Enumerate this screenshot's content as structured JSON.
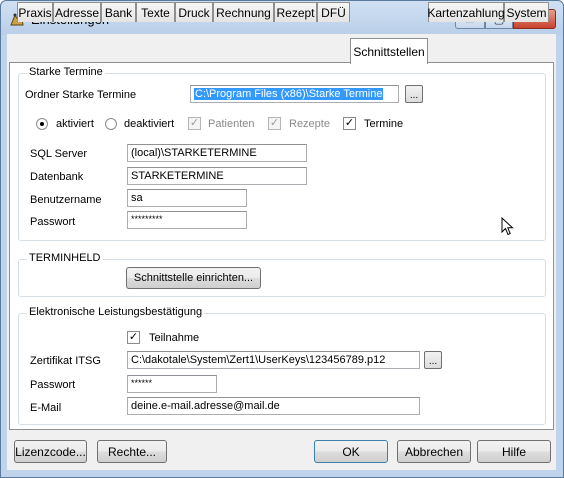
{
  "window": {
    "title": "Einstellungen",
    "min_glyph": "▭",
    "max_glyph": "▢",
    "close_glyph": "✕"
  },
  "tabs": [
    {
      "label": "Praxis"
    },
    {
      "label": "Adresse"
    },
    {
      "label": "Bank"
    },
    {
      "label": "Texte"
    },
    {
      "label": "Druck"
    },
    {
      "label": "Rechnung"
    },
    {
      "label": "Rezept"
    },
    {
      "label": "DFÜ"
    },
    {
      "label": "Schnittstellen",
      "active": true
    },
    {
      "label": "Kartenzahlung"
    },
    {
      "label": "System"
    }
  ],
  "starke_termine": {
    "group_title": "Starke Termine",
    "ordner_label": "Ordner Starke Termine",
    "ordner_value": "C:\\Program Files (x86)\\Starke Termine",
    "browse_label": "...",
    "radio_aktiviert": "aktiviert",
    "radio_deaktiviert": "deaktiviert",
    "chk_patienten": "Patienten",
    "chk_rezepte": "Rezepte",
    "chk_termine": "Termine",
    "check_mark": "✓",
    "sql_label": "SQL Server",
    "sql_value": "(local)\\STARKETERMINE",
    "db_label": "Datenbank",
    "db_value": "STARKETERMINE",
    "user_label": "Benutzername",
    "user_value": "sa",
    "pw_label": "Passwort",
    "pw_value": "*********"
  },
  "terminheld": {
    "group_title": "TERMINHELD",
    "button_label": "Schnittstelle einrichten..."
  },
  "elb": {
    "group_title": "Elektronische Leistungsbestätigung",
    "teilnahme_label": "Teilnahme",
    "zert_label": "Zertifikat ITSG",
    "zert_value": "C:\\dakotale\\System\\Zert1\\UserKeys\\123456789.p12",
    "browse_label": "...",
    "pw_label": "Passwort",
    "pw_value": "******",
    "email_label": "E-Mail",
    "email_value": "deine.e-mail.adresse@mail.de"
  },
  "footer": {
    "lizenz": "Lizenzcode...",
    "rechte": "Rechte...",
    "ok": "OK",
    "abbrechen": "Abbrechen",
    "hilfe": "Hilfe"
  },
  "colors": {
    "frame": "#bfd3ea",
    "selection": "#3399ff",
    "close_button": "#c8422c"
  }
}
